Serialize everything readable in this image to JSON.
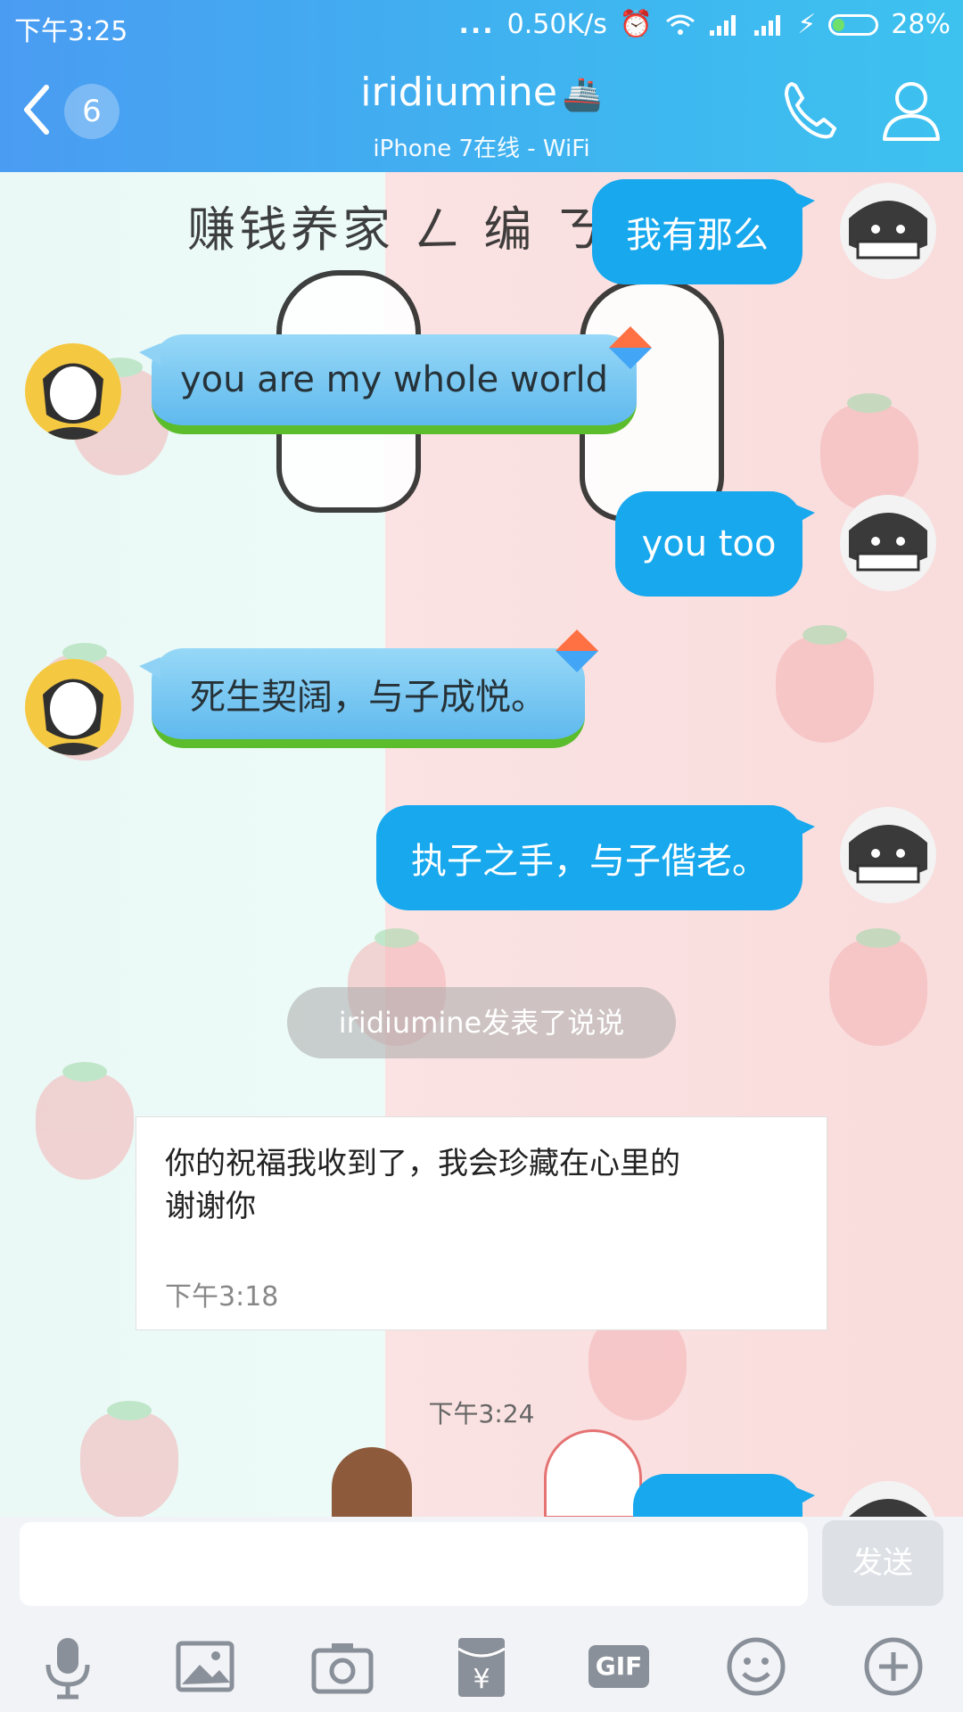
{
  "status_bar": {
    "time": "下午3:25",
    "signal_dots": "...",
    "net_speed": "0.50K/s",
    "battery_percent": "28%",
    "battery_level": 0.28
  },
  "header": {
    "back_count": "6",
    "title": "iridiumine",
    "title_icon": "ship-icon",
    "subtitle": "iPhone 7在线 - WiFi"
  },
  "background_art": {
    "text": "赚钱养家 ㄥ 编 ㄋ"
  },
  "messages": [
    {
      "side": "out",
      "text": "我有那么"
    },
    {
      "side": "in",
      "text": "you are my whole world"
    },
    {
      "side": "out",
      "text": "you too"
    },
    {
      "side": "in",
      "text": "死生契阔，与子成悦。"
    },
    {
      "side": "out",
      "text": "执子之手，与子偕老。"
    }
  ],
  "notice": "iridiumine发表了说说",
  "post_card": {
    "text": "你的祝福我收到了，我会珍藏在心里的\n谢谢你",
    "time": "下午3:18"
  },
  "time_separator": "下午3:24",
  "input": {
    "value": "",
    "send_label": "发送"
  },
  "toolbar": [
    {
      "icon": "microphone-icon"
    },
    {
      "icon": "image-icon"
    },
    {
      "icon": "camera-icon"
    },
    {
      "icon": "red-packet-icon"
    },
    {
      "icon": "gif-icon",
      "label": "GIF"
    },
    {
      "icon": "emoji-icon"
    },
    {
      "icon": "plus-icon"
    }
  ],
  "colors": {
    "header_gradient_start": "#4a9cf2",
    "header_gradient_end": "#3dc2ef",
    "outgoing_bubble": "#17a8ee",
    "incoming_bubble": "#7cc9f3",
    "send_button_disabled": "#dde1e6"
  }
}
